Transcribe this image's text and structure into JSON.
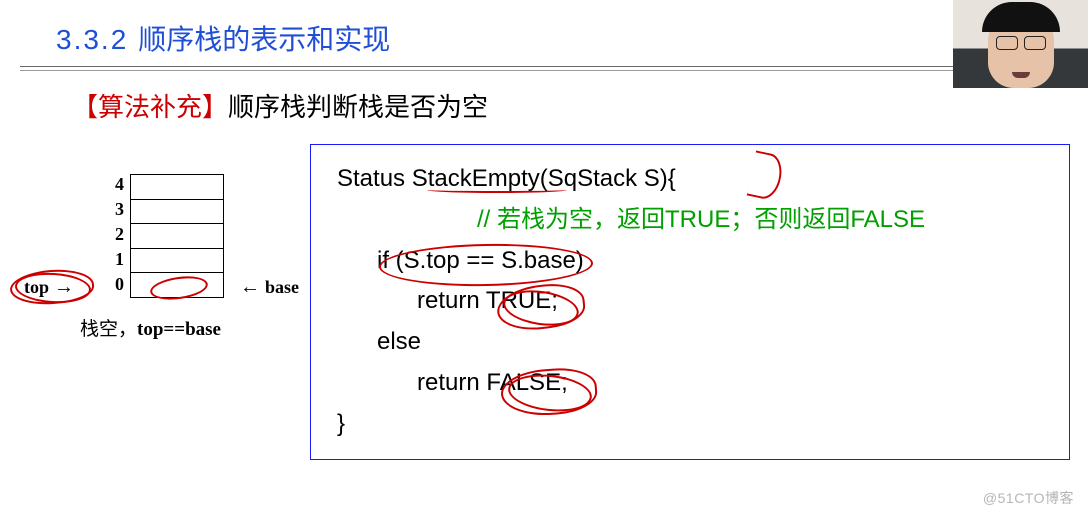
{
  "header": {
    "number": "3.3.2",
    "title": "顺序栈的表示和实现"
  },
  "subtitle": {
    "bracket": "【算法补充】",
    "text": "顺序栈判断栈是否为空"
  },
  "diagram": {
    "indices": [
      "4",
      "3",
      "2",
      "1",
      "0"
    ],
    "label_top": "top",
    "label_base": "base",
    "caption_prefix": "栈空，",
    "caption_cond": "top==base"
  },
  "code": {
    "l1": "Status StackEmpty(SqStack S){",
    "l2": "// 若栈为空，返回TRUE；否则返回FALSE",
    "l3": "if (S.top == S.base)",
    "l4": "return TRUE;",
    "l5": "else",
    "l6": "return  FALSE;",
    "l7": "}"
  },
  "watermark": "@51CTO博客"
}
